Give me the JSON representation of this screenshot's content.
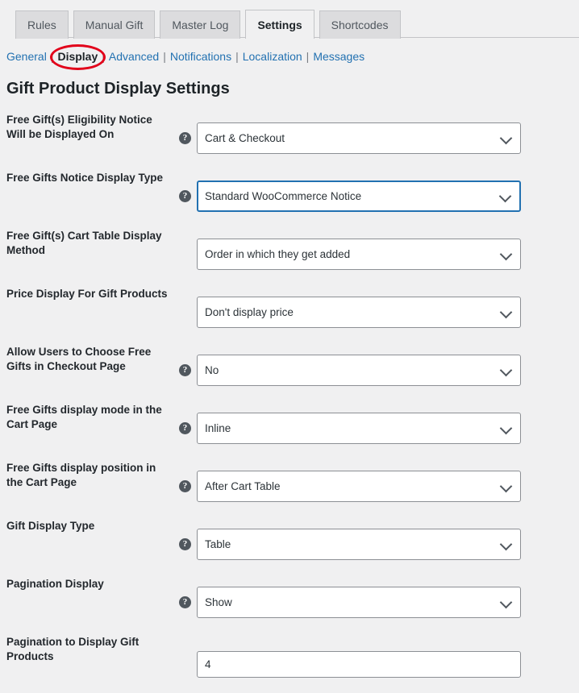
{
  "tabs": [
    {
      "label": "Rules",
      "active": false
    },
    {
      "label": "Manual Gift",
      "active": false
    },
    {
      "label": "Master Log",
      "active": false
    },
    {
      "label": "Settings",
      "active": true
    },
    {
      "label": "Shortcodes",
      "active": false
    }
  ],
  "subnav": {
    "items": [
      {
        "label": "General",
        "current": false
      },
      {
        "label": "Display",
        "current": true
      },
      {
        "label": "Advanced",
        "current": false
      },
      {
        "label": "Notifications",
        "current": false
      },
      {
        "label": "Localization",
        "current": false
      },
      {
        "label": "Messages",
        "current": false
      }
    ],
    "separator": "|"
  },
  "annotation": {
    "type": "ellipse-highlight",
    "target": "Display",
    "color": "#e2001a"
  },
  "page": {
    "title": "Gift Product Display Settings"
  },
  "colors": {
    "background": "#f0f0f1",
    "tab_inactive": "#dcdcde",
    "link": "#2271b1",
    "focus_border": "#2271b1",
    "label": "#23282d",
    "annotation_red": "#e2001a"
  },
  "help_icon_glyph": "?",
  "fields": [
    {
      "label": "Free Gift(s) Eligibility Notice Will be Displayed On",
      "help": true,
      "type": "select",
      "value": "Cart & Checkout",
      "focused": false
    },
    {
      "label": "Free Gifts Notice Display Type",
      "help": true,
      "type": "select",
      "value": "Standard WooCommerce Notice",
      "focused": true
    },
    {
      "label": "Free Gift(s) Cart Table Display Method",
      "help": false,
      "type": "select",
      "value": "Order in which they get added",
      "focused": false
    },
    {
      "label": "Price Display For Gift Products",
      "help": false,
      "type": "select",
      "value": "Don't display price",
      "focused": false
    },
    {
      "label": "Allow Users to Choose Free Gifts in Checkout Page",
      "help": true,
      "type": "select",
      "value": "No",
      "focused": false
    },
    {
      "label": "Free Gifts display mode in the Cart Page",
      "help": true,
      "type": "select",
      "value": "Inline",
      "focused": false
    },
    {
      "label": "Free Gifts display position in the Cart Page",
      "help": true,
      "type": "select",
      "value": "After Cart Table",
      "focused": false
    },
    {
      "label": "Gift Display Type",
      "help": true,
      "type": "select",
      "value": "Table",
      "focused": false
    },
    {
      "label": "Pagination Display",
      "help": true,
      "type": "select",
      "value": "Show",
      "focused": false
    },
    {
      "label": "Pagination to Display Gift Products",
      "help": false,
      "type": "text",
      "value": "4",
      "focused": false
    }
  ]
}
